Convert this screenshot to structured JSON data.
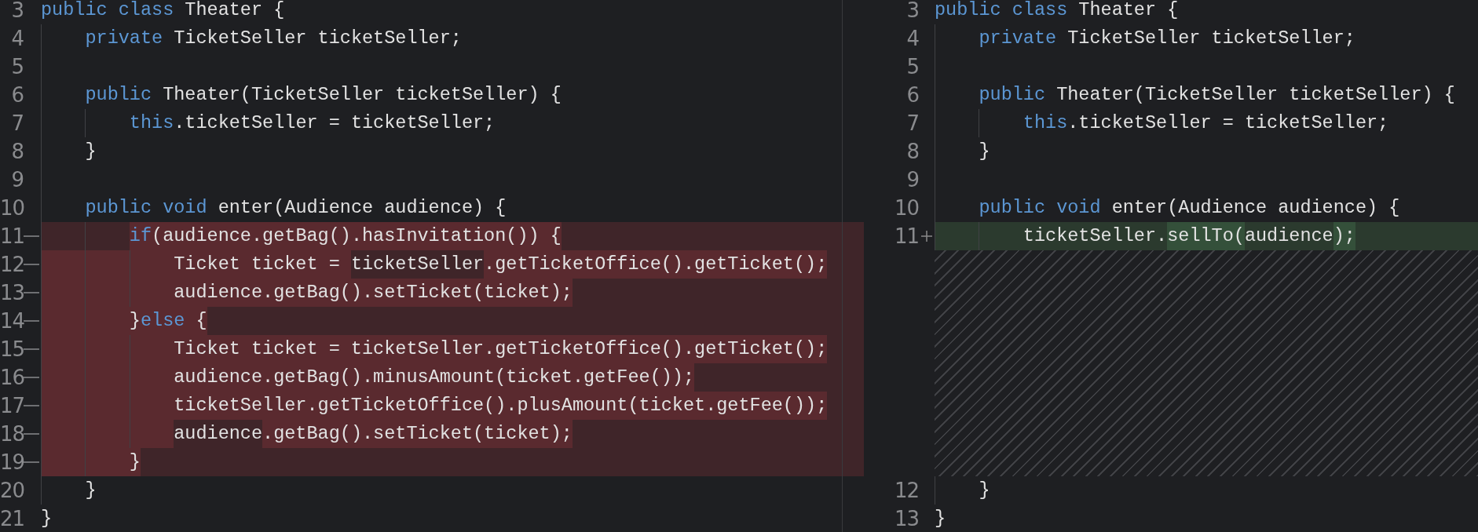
{
  "left": {
    "lines": [
      {
        "number": "3",
        "kind": "context",
        "tokens": [
          {
            "text": "public class",
            "kind": "keyword"
          },
          {
            "text": " Theater {",
            "kind": "plain"
          }
        ]
      },
      {
        "number": "4",
        "kind": "context",
        "tokens": [
          {
            "text": "    private",
            "kind": "keyword"
          },
          {
            "text": " TicketSeller ticketSeller;",
            "kind": "plain"
          }
        ]
      },
      {
        "number": "5",
        "kind": "context"
      },
      {
        "number": "6",
        "kind": "context",
        "tokens": [
          {
            "text": "    public",
            "kind": "keyword"
          },
          {
            "text": " Theater(TicketSeller ticketSeller) {",
            "kind": "plain"
          }
        ]
      },
      {
        "number": "7",
        "kind": "context",
        "tokens": [
          {
            "text": "        this",
            "kind": "keyword"
          },
          {
            "text": ".ticketSeller = ticketSeller;",
            "kind": "plain"
          }
        ]
      },
      {
        "number": "8",
        "kind": "context",
        "tokens": [
          {
            "text": "    }",
            "kind": "plain"
          }
        ]
      },
      {
        "number": "9",
        "kind": "context"
      },
      {
        "number": "10",
        "kind": "context",
        "tokens": [
          {
            "text": "    public void",
            "kind": "keyword"
          },
          {
            "text": " enter(Audience audience) {",
            "kind": "plain"
          }
        ]
      },
      {
        "number": "11",
        "kind": "removed",
        "indent_changed": false,
        "tokens": [
          {
            "text": "        if",
            "kind": "keyword",
            "changed": true
          },
          {
            "text": "(audience.getBag().hasInvitation()) {",
            "kind": "plain",
            "changed": true
          }
        ]
      },
      {
        "number": "12",
        "kind": "removed",
        "indent_changed": true,
        "tokens": [
          {
            "text": "            Ticket ticket = ",
            "kind": "plain",
            "changed": true
          },
          {
            "text": "ticketSeller",
            "kind": "plain",
            "changed": false
          },
          {
            "text": ".getTicketOffice().getTicket();",
            "kind": "plain",
            "changed": true
          }
        ]
      },
      {
        "number": "13",
        "kind": "removed",
        "indent_changed": true,
        "tokens": [
          {
            "text": "            audience.getBag().setTicket(ticket);",
            "kind": "plain",
            "changed": true
          }
        ]
      },
      {
        "number": "14",
        "kind": "removed",
        "indent_changed": true,
        "tokens": [
          {
            "text": "        }",
            "kind": "plain",
            "changed": true
          },
          {
            "text": "else",
            "kind": "keyword",
            "changed": true
          },
          {
            "text": " {",
            "kind": "plain",
            "changed": true
          }
        ]
      },
      {
        "number": "15",
        "kind": "removed",
        "indent_changed": true,
        "tokens": [
          {
            "text": "            Ticket ticket = ticketSeller.getTicketOffice().getTicket();",
            "kind": "plain",
            "changed": true
          }
        ]
      },
      {
        "number": "16",
        "kind": "removed",
        "indent_changed": true,
        "tokens": [
          {
            "text": "            audience.getBag().minusAmount(ticket.getFee());",
            "kind": "plain",
            "changed": true
          }
        ]
      },
      {
        "number": "17",
        "kind": "removed",
        "indent_changed": true,
        "tokens": [
          {
            "text": "            ticketSeller.getTicketOffice().plusAmount(ticket.getFee());",
            "kind": "plain",
            "changed": true
          }
        ]
      },
      {
        "number": "18",
        "kind": "removed",
        "indent_changed": true,
        "tokens": [
          {
            "text": "            audience",
            "kind": "plain",
            "changed": false
          },
          {
            "text": ".getBag().setTicket(ticket);",
            "kind": "plain",
            "changed": true
          }
        ]
      },
      {
        "number": "19",
        "kind": "removed",
        "indent_changed": true,
        "tokens": [
          {
            "text": "        }",
            "kind": "plain",
            "changed": true
          }
        ]
      },
      {
        "number": "20",
        "kind": "context",
        "tokens": [
          {
            "text": "    }",
            "kind": "plain"
          }
        ]
      },
      {
        "number": "21",
        "kind": "context",
        "tokens": [
          {
            "text": "}",
            "kind": "plain"
          }
        ]
      }
    ]
  },
  "right": {
    "lines": [
      {
        "number": "3",
        "kind": "context",
        "removed_marker": false,
        "tokens": [
          {
            "text": "public class",
            "kind": "keyword"
          },
          {
            "text": " Theater {",
            "kind": "plain"
          }
        ]
      },
      {
        "number": "4",
        "kind": "context",
        "removed_marker": false,
        "tokens": [
          {
            "text": "    private",
            "kind": "keyword"
          },
          {
            "text": " TicketSeller ticketSeller;",
            "kind": "plain"
          }
        ]
      },
      {
        "number": "5",
        "kind": "context",
        "removed_marker": false
      },
      {
        "number": "6",
        "kind": "context",
        "removed_marker": false,
        "tokens": [
          {
            "text": "    public",
            "kind": "keyword"
          },
          {
            "text": " Theater(TicketSeller ticketSeller) {",
            "kind": "plain"
          }
        ]
      },
      {
        "number": "7",
        "kind": "context",
        "removed_marker": false,
        "tokens": [
          {
            "text": "        this",
            "kind": "keyword"
          },
          {
            "text": ".ticketSeller = ticketSeller;",
            "kind": "plain"
          }
        ]
      },
      {
        "number": "8",
        "kind": "context",
        "removed_marker": false,
        "tokens": [
          {
            "text": "    }",
            "kind": "plain"
          }
        ]
      },
      {
        "number": "9",
        "kind": "context",
        "removed_marker": false
      },
      {
        "number": "10",
        "kind": "context",
        "removed_marker": false,
        "tokens": [
          {
            "text": "    public void",
            "kind": "keyword"
          },
          {
            "text": " enter(Audience audience) {",
            "kind": "plain"
          }
        ]
      },
      {
        "number": "11",
        "kind": "added",
        "removed_marker": true,
        "indent_changed": false,
        "tokens": [
          {
            "text": "        ticketSeller.",
            "kind": "plain",
            "changed": false
          },
          {
            "text": "sellTo(",
            "kind": "plain",
            "changed": true
          },
          {
            "text": "audience",
            "kind": "plain",
            "changed": false
          },
          {
            "text": ");",
            "kind": "plain",
            "changed": true
          }
        ]
      },
      {
        "kind": "filler",
        "removed_marker": true
      },
      {
        "kind": "filler",
        "removed_marker": true
      },
      {
        "kind": "filler",
        "removed_marker": true
      },
      {
        "kind": "filler",
        "removed_marker": true
      },
      {
        "kind": "filler",
        "removed_marker": true
      },
      {
        "kind": "filler",
        "removed_marker": true
      },
      {
        "kind": "filler",
        "removed_marker": true
      },
      {
        "kind": "filler",
        "removed_marker": true
      },
      {
        "number": "12",
        "kind": "context",
        "removed_marker": false,
        "tokens": [
          {
            "text": "    }",
            "kind": "plain"
          }
        ]
      },
      {
        "number": "13",
        "kind": "context",
        "removed_marker": false,
        "tokens": [
          {
            "text": "}",
            "kind": "plain"
          }
        ]
      }
    ]
  }
}
